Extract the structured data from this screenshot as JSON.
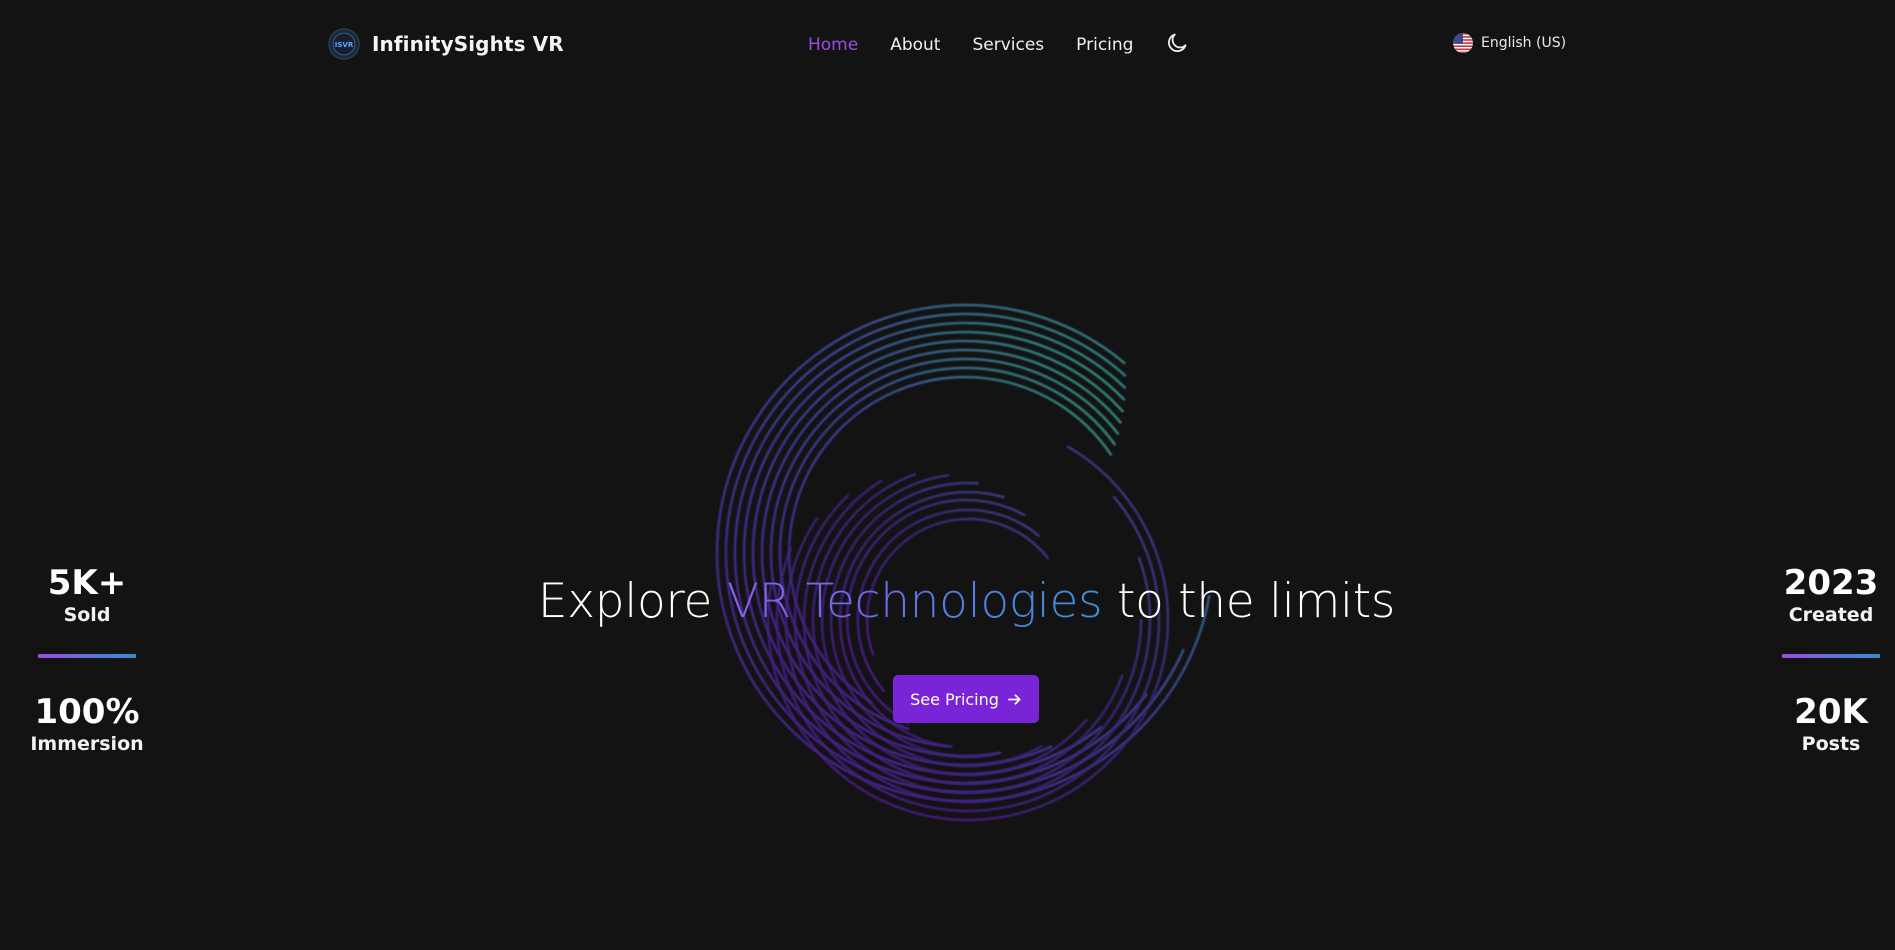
{
  "header": {
    "brand": "InfinitySights VR",
    "logo_text": "ISVR",
    "nav": [
      {
        "label": "Home",
        "active": true
      },
      {
        "label": "About",
        "active": false
      },
      {
        "label": "Services",
        "active": false
      },
      {
        "label": "Pricing",
        "active": false
      }
    ],
    "theme_toggle_icon": "moon-icon",
    "language": {
      "label": "English (US)",
      "flag_icon": "us-flag-icon"
    }
  },
  "hero": {
    "headline_before": "Explore ",
    "headline_highlight": "VR Technologies",
    "headline_after": " to the limits",
    "cta_label": "See Pricing",
    "cta_icon": "arrow-right-icon"
  },
  "stats_left": [
    {
      "value": "5K+",
      "label": "Sold"
    },
    {
      "value": "100%",
      "label": "Immersion"
    }
  ],
  "stats_right": [
    {
      "value": "2023",
      "label": "Created"
    },
    {
      "value": "20K",
      "label": "Posts"
    }
  ],
  "colors": {
    "background": "#131313",
    "accent": "#7a24d8",
    "nav_active": "#9b4dea",
    "gradient_start": "#9a4fe8",
    "gradient_end": "#2d8ed4",
    "ring_purple": "#4b1d86",
    "ring_teal": "#2a8f74"
  }
}
